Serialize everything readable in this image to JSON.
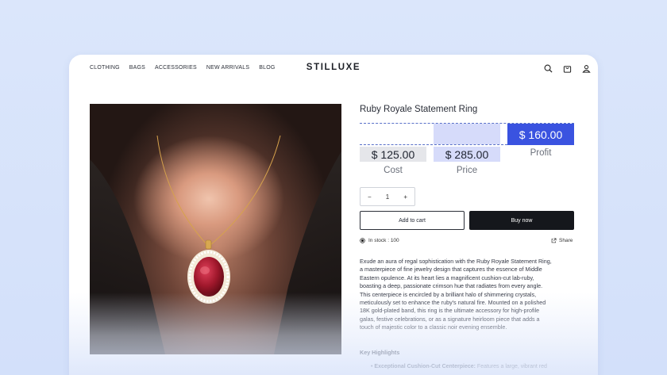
{
  "nav": {
    "links": [
      "CLOTHING",
      "BAGS",
      "ACCESSORIES",
      "NEW ARRIVALS",
      "BLOG"
    ],
    "brand": "STILLUXE",
    "icons": [
      "search-icon",
      "cart-icon",
      "user-icon"
    ]
  },
  "product": {
    "title": "Ruby Royale Statement Ring",
    "cost": "$ 125.00",
    "price": "$ 285.00",
    "profit": "$ 160.00",
    "cost_label": "Cost",
    "price_label": "Price",
    "profit_label": "Profit",
    "quantity": "1",
    "add_to_cart": "Add to cart",
    "buy_now": "Buy now",
    "stock": "In stock : 100",
    "share": "Share",
    "description_lines": [
      "Exude an aura of regal sophistication with the Ruby Royale Statement Ring,",
      "a masterpiece of fine jewelry design that captures the essence of Middle",
      "Eastern opulence. At its heart lies a magnificent cushion-cut lab-ruby,",
      "boasting a deep, passionate crimson hue that radiates from every angle.",
      "This centerpiece is encircled by a brilliant halo of shimmering crystals,",
      "meticulously set to enhance the ruby's natural fire. Mounted on a polished",
      "18K gold-plated band, this ring is the ultimate accessory for high-profile",
      "galas, festive celebrations, or as a signature heirloom piece that adds a",
      "touch of majestic color to a classic noir evening ensemble."
    ],
    "highlights_title": "Key Highlights",
    "highlight_1_title": "Exceptional Cushion-Cut Centerpiece:",
    "highlight_1_text": " Features a large, vibrant red"
  },
  "colors": {
    "accent": "#3a53e0",
    "accent_light": "#d6dbfa",
    "buy_button": "#15171c",
    "background": "#d8e3fb"
  }
}
